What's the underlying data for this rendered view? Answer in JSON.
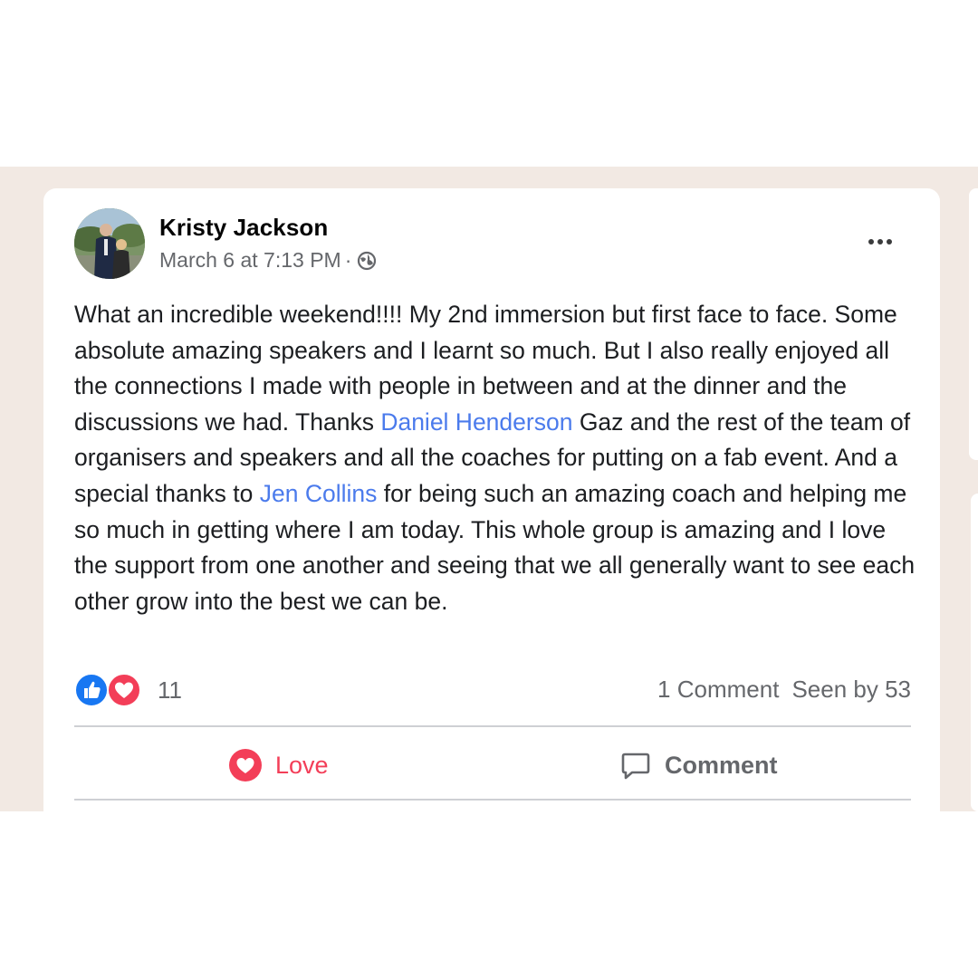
{
  "post": {
    "author": "Kristy Jackson",
    "timestamp": "March 6 at 7:13 PM",
    "privacy_icon": "globe-icon",
    "text_parts": [
      "What an incredible weekend!!!! My 2nd immersion but first face to face. Some absolute amazing speakers and I learnt so much. But I also really enjoyed all the connections I made with people in between and at the dinner and the discussions we had.  Thanks ",
      "Daniel Henderson",
      " Gaz and the rest of the team of organisers and speakers and all the coaches for putting on a fab event. And a special thanks to ",
      "Jen Collins",
      " for being such an amazing coach and helping me so much in getting where I am today. This whole group is amazing and I love the support from one another and seeing that we all generally want to see each other grow into the best we can be."
    ],
    "reaction_count": "11",
    "comment_count": "1 Comment",
    "seen_by": "Seen by 53"
  },
  "actions": {
    "love_label": "Love",
    "comment_label": "Comment"
  },
  "colors": {
    "mention": "#4b7bec",
    "love": "#f33e58",
    "like": "#1877f2",
    "backdrop": "#f2e9e3"
  }
}
